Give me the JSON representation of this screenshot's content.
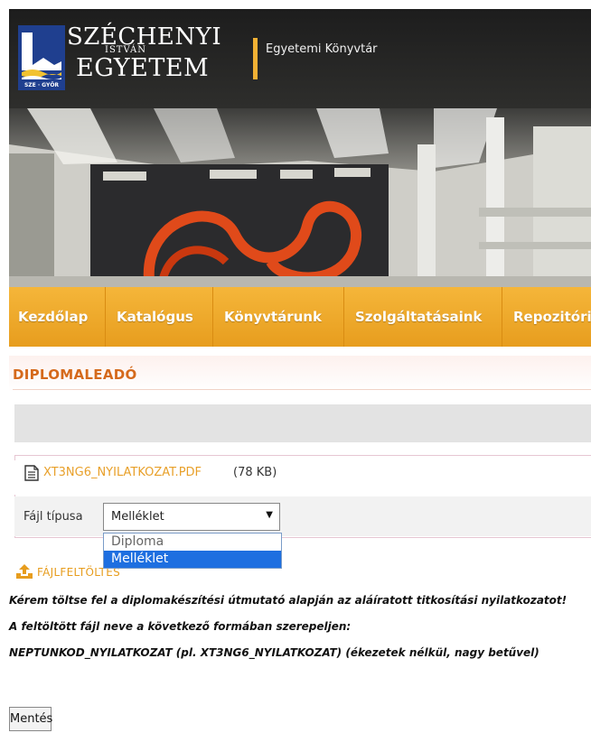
{
  "header": {
    "logo_line1": "SZÉCHENYI",
    "logo_line2": "ISTVÁN",
    "logo_line3": "EGYETEM",
    "logo_badge": "SZE · GYŐR",
    "site_name": "Egyetemi Könyvtár"
  },
  "nav": {
    "items": [
      {
        "label": "Kezdőlap"
      },
      {
        "label": "Katalógus"
      },
      {
        "label": "Könyvtárunk"
      },
      {
        "label": "Szolgáltatásaink"
      },
      {
        "label": "Repozitóri"
      }
    ]
  },
  "page": {
    "title": "DIPLOMALEADÓ"
  },
  "file": {
    "name": "XT3NG6_NYILATKOZAT.PDF",
    "size": "(78 KB)",
    "type_label": "Fájl típusa",
    "type_selected": "Melléklet",
    "type_options": [
      "Diploma",
      "Melléklet"
    ]
  },
  "upload": {
    "label": "FÁJLFELTÖLTÉS"
  },
  "instructions": {
    "line1": "Kérem töltse fel a diplomakészítési útmutató alapján az aláíratott titkosítási nyilatkozatot!",
    "line2": "A feltöltött fájl neve a következő  formában szerepeljen:",
    "line3": "NEPTUNKOD_NYILATKOZAT (pl. XT3NG6_NYILATKOZAT) (ékezetek nélkül, nagy betűvel)"
  },
  "actions": {
    "save_label": "Mentés"
  },
  "colors": {
    "accent_orange": "#e79d1e",
    "title_orange": "#d56a1c",
    "select_highlight": "#1e6fe0",
    "logo_blue": "#1f3f8f"
  }
}
